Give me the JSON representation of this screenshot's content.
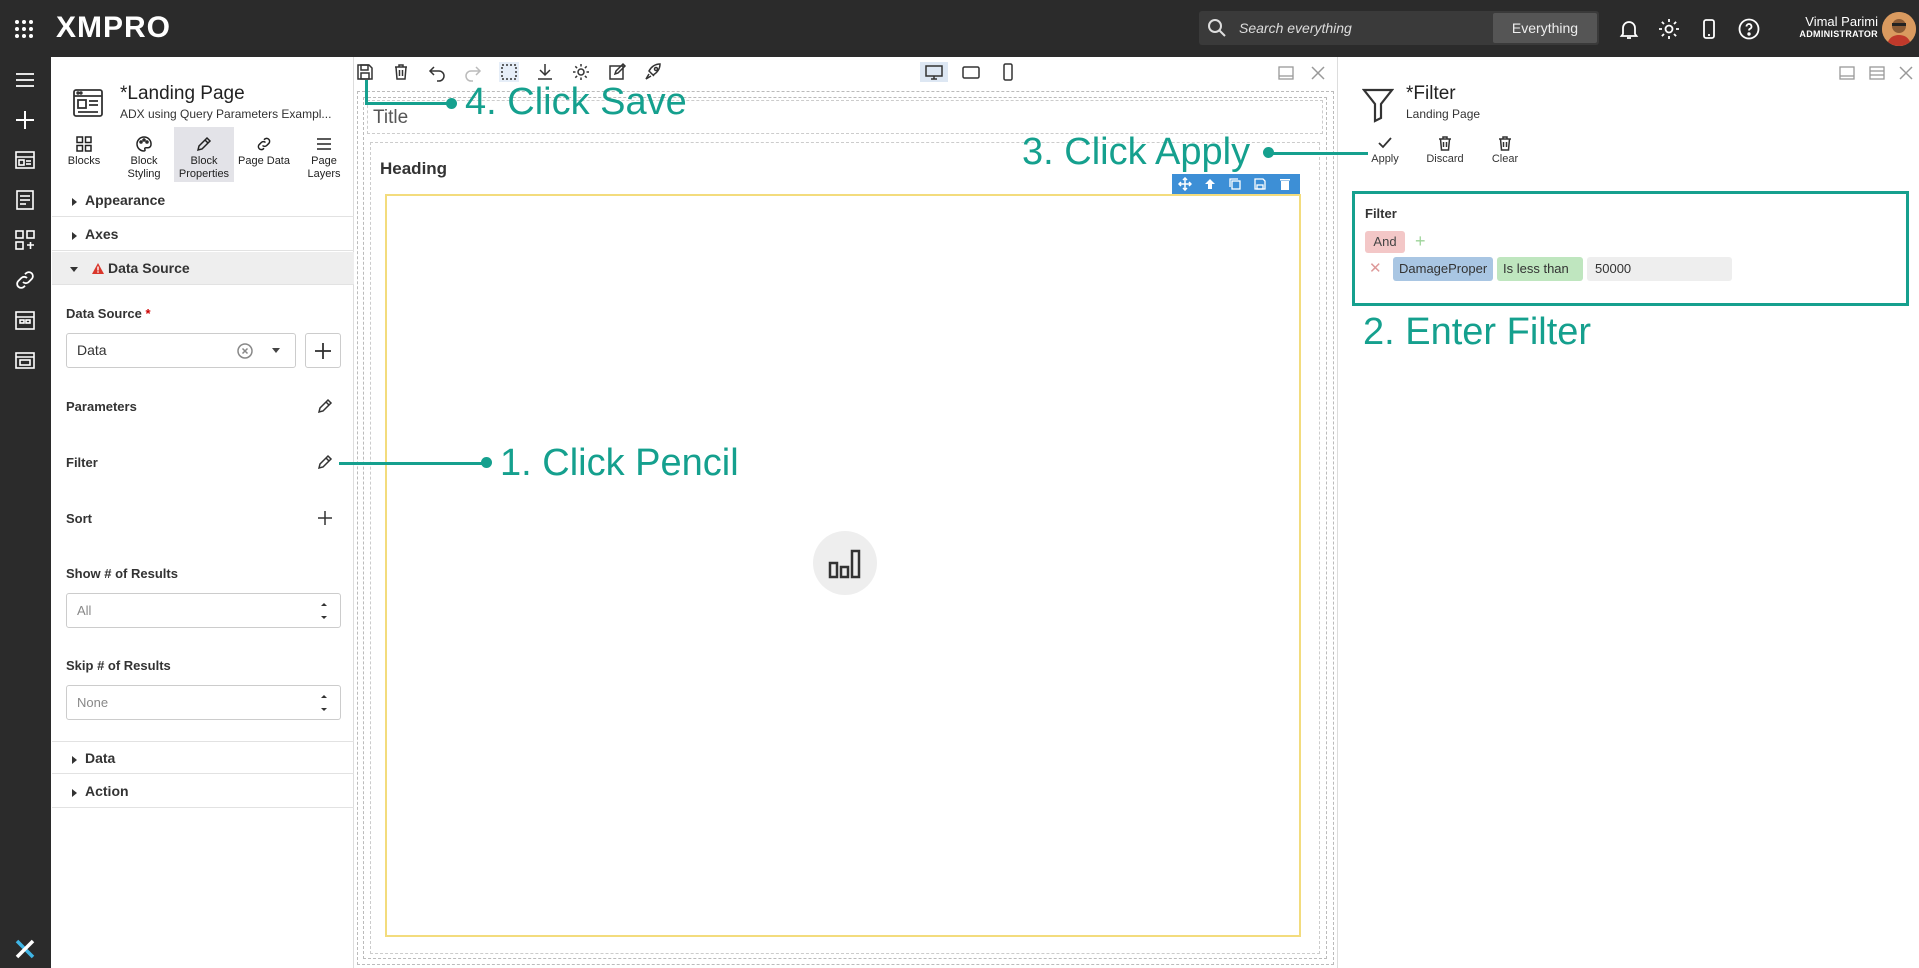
{
  "topbar": {
    "logo": "XMPRO",
    "search_placeholder": "Search everything",
    "search_scope": "Everything",
    "user_name": "Vimal Parimi",
    "user_role": "ADMINISTRATOR"
  },
  "page": {
    "title": "*Landing Page",
    "subtitle": "ADX using Query Parameters Exampl..."
  },
  "tabs": [
    {
      "label": "Blocks"
    },
    {
      "label": "Block Styling"
    },
    {
      "label": "Block Properties"
    },
    {
      "label": "Page Data"
    },
    {
      "label": "Page Layers"
    }
  ],
  "sections": {
    "appearance": "Appearance",
    "axes": "Axes",
    "data_source": "Data Source",
    "data": "Data",
    "action": "Action"
  },
  "form": {
    "data_source_label": "Data Source",
    "required_mark": "*",
    "data_source_value": "Data",
    "parameters_label": "Parameters",
    "filter_label": "Filter",
    "sort_label": "Sort",
    "show_results_label": "Show # of Results",
    "show_results_placeholder": "All",
    "skip_results_label": "Skip # of Results",
    "skip_results_placeholder": "None"
  },
  "canvas": {
    "title_text": "Title",
    "heading_text": "Heading"
  },
  "filter_panel": {
    "title": "*Filter",
    "subtitle": "Landing Page",
    "apply_label": "Apply",
    "discard_label": "Discard",
    "clear_label": "Clear",
    "section_title": "Filter",
    "group_operator": "And",
    "field": "DamageProper",
    "operator": "Is less than",
    "value": "50000"
  },
  "annotations": {
    "step1": "1. Click Pencil",
    "step2": "2. Enter Filter",
    "step3": "3. Click Apply",
    "step4": "4. Click Save"
  },
  "colors": {
    "topbar": "#2b2b2b",
    "annotation": "#15a08e",
    "chart_border": "#f3dc7d",
    "block_toolbar": "#3d8fd6"
  }
}
